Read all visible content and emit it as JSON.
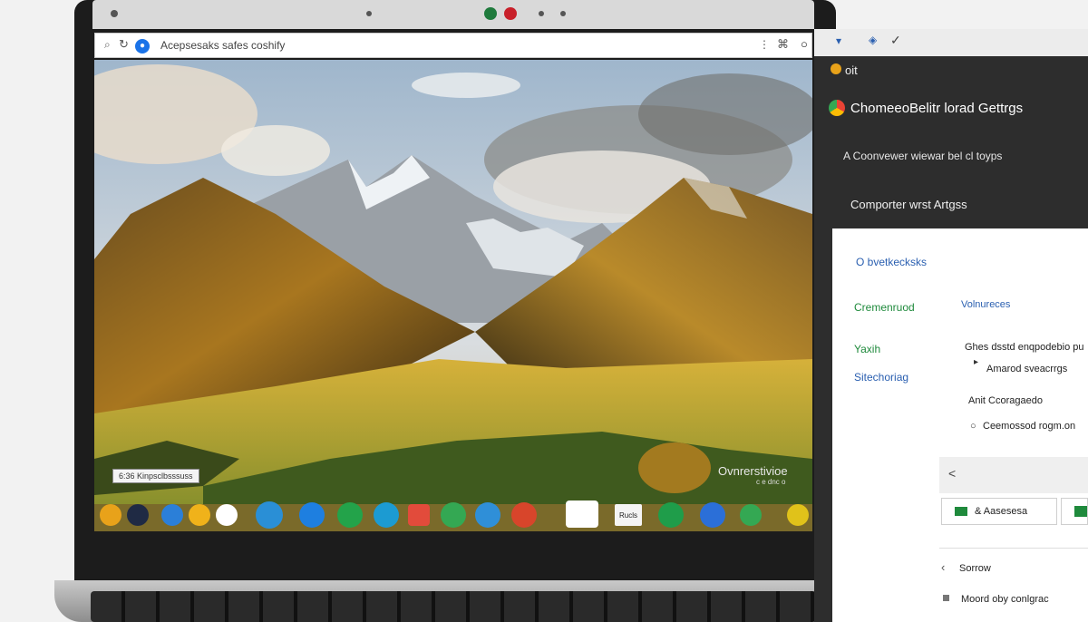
{
  "browser": {
    "url_text": "Acepsesaks safes coshify"
  },
  "screen": {
    "tray_label": "6:36 Kinpsclbsssuss",
    "watermark": "Ovnrerstivioe",
    "watermark_sub": "c e dnc o"
  },
  "shelf": {
    "apps": [
      {
        "icon": "chrome-icon",
        "color": "#e8a21a"
      },
      {
        "icon": "circle-app-icon",
        "color": "#1f2a44"
      },
      {
        "icon": "globe-icon",
        "color": "#2b7fd8"
      },
      {
        "icon": "sun-app-icon",
        "color": "#f0b21a"
      },
      {
        "icon": "photos-app-icon",
        "color": "#ffffff"
      },
      {
        "icon": "wave-app-icon",
        "color": "#2a8fd6"
      },
      {
        "icon": "chat-app-icon",
        "color": "#1e7fe0"
      },
      {
        "icon": "green-app-icon",
        "color": "#23a34a"
      },
      {
        "icon": "drive-app-icon",
        "color": "#1c9bd2"
      },
      {
        "icon": "files-app-icon",
        "color": "#e24b3b"
      },
      {
        "icon": "music-app-icon",
        "color": "#34a853"
      },
      {
        "icon": "tech-app-icon",
        "color": "#2f8fd8"
      },
      {
        "icon": "record-app-icon",
        "color": "#d8452b"
      },
      {
        "icon": "linux-app-icon",
        "color": "#ffffff"
      },
      {
        "icon": "store-app-icon",
        "color": "#f4f4f4"
      },
      {
        "icon": "leaf-app-icon",
        "color": "#1f9d4a"
      },
      {
        "icon": "chrome-blue-icon",
        "color": "#2b6fd8"
      },
      {
        "icon": "maps-app-icon",
        "color": "#34a853"
      },
      {
        "icon": "yellow-app-icon",
        "color": "#e0c21a"
      }
    ],
    "store_label": "Rucls"
  },
  "panel": {
    "top_icons": [
      "filter-icon",
      "shield-icon",
      "check-icon"
    ],
    "brand": "oit",
    "title": "ChomeeoBelitr lorad Gettrgs",
    "subtitle": "A Coonvewer wiewar bel cl toyps",
    "row1": "Comporter wrst   Artgss",
    "section": "O bvetkecksks",
    "nav": [
      "Cremenruod",
      "Yaxih",
      "Sitechoriag"
    ],
    "details": {
      "header": "Volnureces",
      "line1": "Ghes dsstd enqpodebio pu",
      "line2": "Amarod sveacrrgs",
      "line3": "Anit Ccoragaedo",
      "line4": "Ceemossod rogm.on"
    },
    "back_label": "<",
    "add_button": "& Aasesesa",
    "settings_label": "Sorrow",
    "about_label": "Moord oby conlgrac"
  },
  "colors": {
    "accent_green": "#1f8a3c",
    "link_blue": "#2a5fb0",
    "panel_dark": "#2d2d2d"
  }
}
